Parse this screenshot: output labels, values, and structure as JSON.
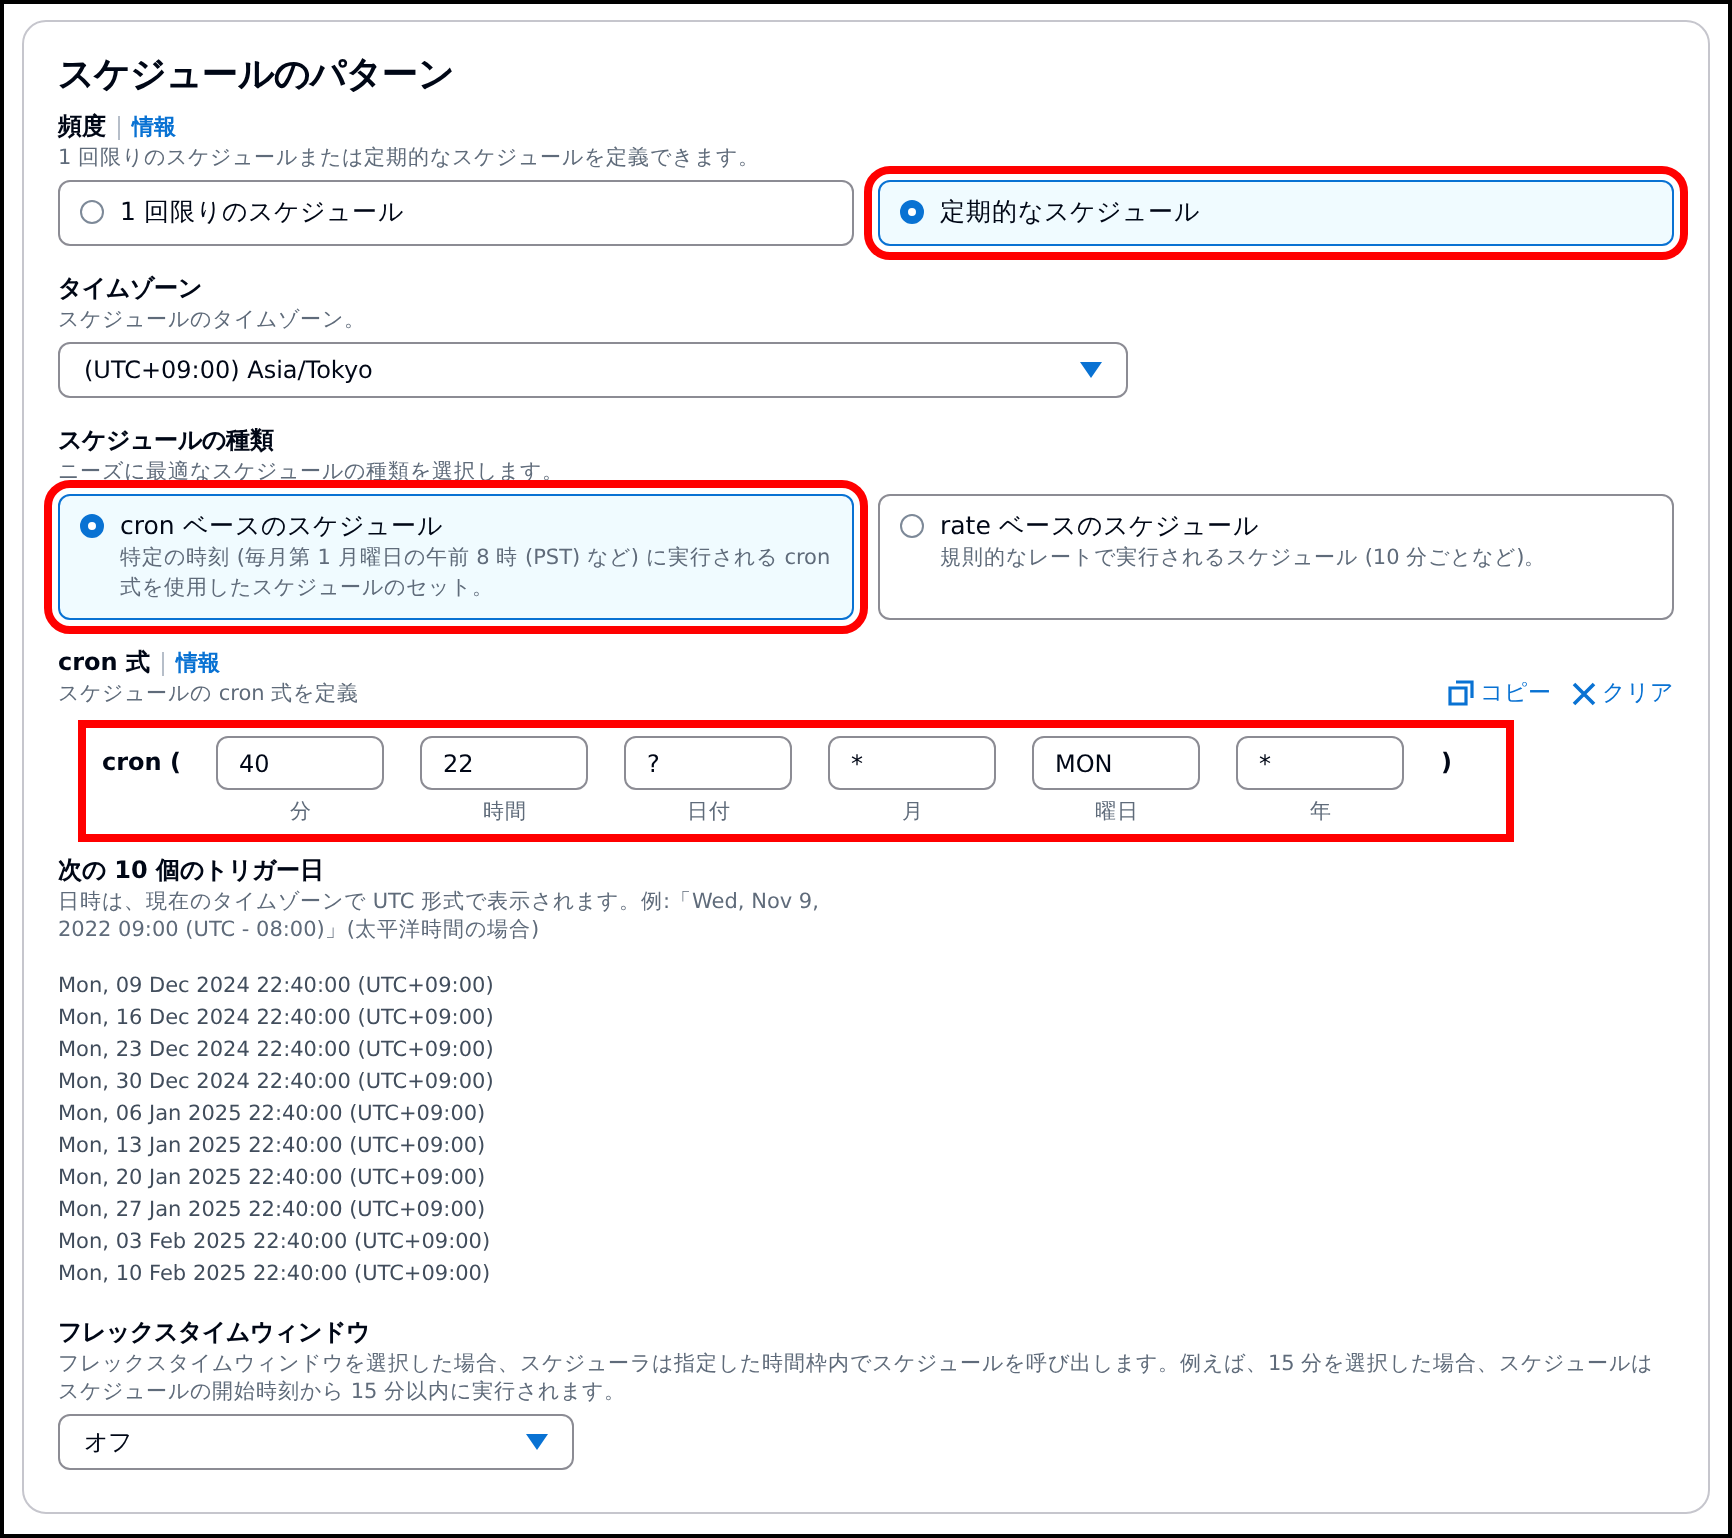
{
  "title": "スケジュールのパターン",
  "frequency": {
    "label": "頻度",
    "info": "情報",
    "description": "1 回限りのスケジュールまたは定期的なスケジュールを定義できます。",
    "options": [
      {
        "label": "1 回限りのスケジュール",
        "selected": false,
        "highlighted": false
      },
      {
        "label": "定期的なスケジュール",
        "selected": true,
        "highlighted": true
      }
    ]
  },
  "timezone": {
    "label": "タイムゾーン",
    "description": "スケジュールのタイムゾーン。",
    "value": "(UTC+09:00) Asia/Tokyo"
  },
  "schedule_type": {
    "label": "スケジュールの種類",
    "description": "ニーズに最適なスケジュールの種類を選択します。",
    "options": [
      {
        "label": "cron ベースのスケジュール",
        "description": "特定の時刻 (毎月第 1 月曜日の午前 8 時 (PST) など) に実行される cron 式を使用したスケジュールのセット。",
        "selected": true,
        "highlighted": true
      },
      {
        "label": "rate ベースのスケジュール",
        "description": "規則的なレートで実行されるスケジュール (10 分ごとなど)。",
        "selected": false,
        "highlighted": false
      }
    ]
  },
  "cron": {
    "label": "cron 式",
    "info": "情報",
    "description": "スケジュールの cron 式を定義",
    "copy": "コピー",
    "clear": "クリア",
    "prefix": "cron (",
    "suffix": ")",
    "highlighted": true,
    "fields": [
      {
        "value": "40",
        "caption": "分"
      },
      {
        "value": "22",
        "caption": "時間"
      },
      {
        "value": "?",
        "caption": "日付"
      },
      {
        "value": "*",
        "caption": "月"
      },
      {
        "value": "MON",
        "caption": "曜日"
      },
      {
        "value": "*",
        "caption": "年"
      }
    ]
  },
  "triggers": {
    "label": "次の 10 個のトリガー日",
    "description": "日時は、現在のタイムゾーンで UTC 形式で表示されます。例:「Wed, Nov 9, 2022 09:00 (UTC - 08:00)」(太平洋時間の場合)",
    "dates": [
      "Mon, 09 Dec 2024 22:40:00 (UTC+09:00)",
      "Mon, 16 Dec 2024 22:40:00 (UTC+09:00)",
      "Mon, 23 Dec 2024 22:40:00 (UTC+09:00)",
      "Mon, 30 Dec 2024 22:40:00 (UTC+09:00)",
      "Mon, 06 Jan 2025 22:40:00 (UTC+09:00)",
      "Mon, 13 Jan 2025 22:40:00 (UTC+09:00)",
      "Mon, 20 Jan 2025 22:40:00 (UTC+09:00)",
      "Mon, 27 Jan 2025 22:40:00 (UTC+09:00)",
      "Mon, 03 Feb 2025 22:40:00 (UTC+09:00)",
      "Mon, 10 Feb 2025 22:40:00 (UTC+09:00)"
    ]
  },
  "flex_window": {
    "label": "フレックスタイムウィンドウ",
    "description": "フレックスタイムウィンドウを選択した場合、スケジューラは指定した時間枠内でスケジュールを呼び出します。例えば、15 分を選択した場合、スケジュールはスケジュールの開始時刻から 15 分以内に実行されます。",
    "value": "オフ"
  }
}
